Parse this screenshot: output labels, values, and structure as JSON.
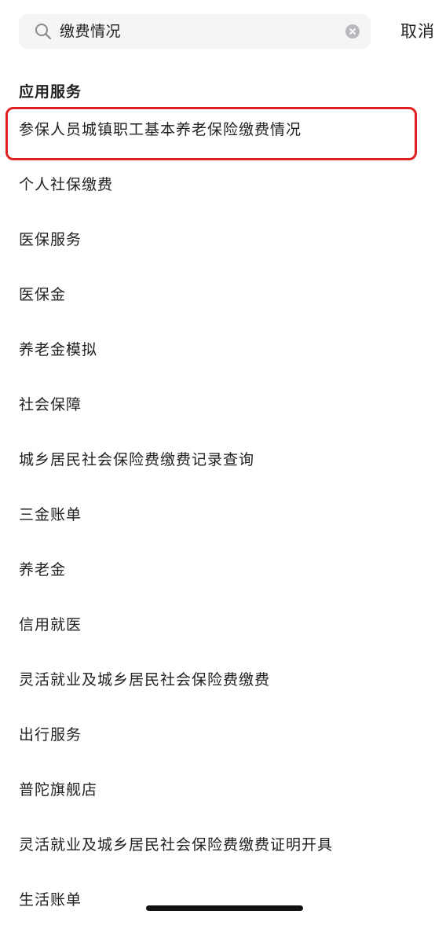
{
  "search": {
    "query": "缴费情况",
    "cancel_label": "取消"
  },
  "section": {
    "title": "应用服务"
  },
  "results": [
    {
      "label": "参保人员城镇职工基本养老保险缴费情况",
      "highlighted": true
    },
    {
      "label": "个人社保缴费"
    },
    {
      "label": "医保服务"
    },
    {
      "label": "医保金"
    },
    {
      "label": "养老金模拟"
    },
    {
      "label": "社会保障"
    },
    {
      "label": "城乡居民社会保险费缴费记录查询"
    },
    {
      "label": "三金账单"
    },
    {
      "label": "养老金"
    },
    {
      "label": "信用就医"
    },
    {
      "label": "灵活就业及城乡居民社会保险费缴费"
    },
    {
      "label": "出行服务"
    },
    {
      "label": "普陀旗舰店"
    },
    {
      "label": "灵活就业及城乡居民社会保险费缴费证明开具"
    },
    {
      "label": "生活账单"
    }
  ],
  "colors": {
    "highlight_border": "#e02020",
    "search_bg": "#f5f5f6"
  },
  "icons": {
    "search": "search-icon",
    "clear": "clear-icon"
  }
}
